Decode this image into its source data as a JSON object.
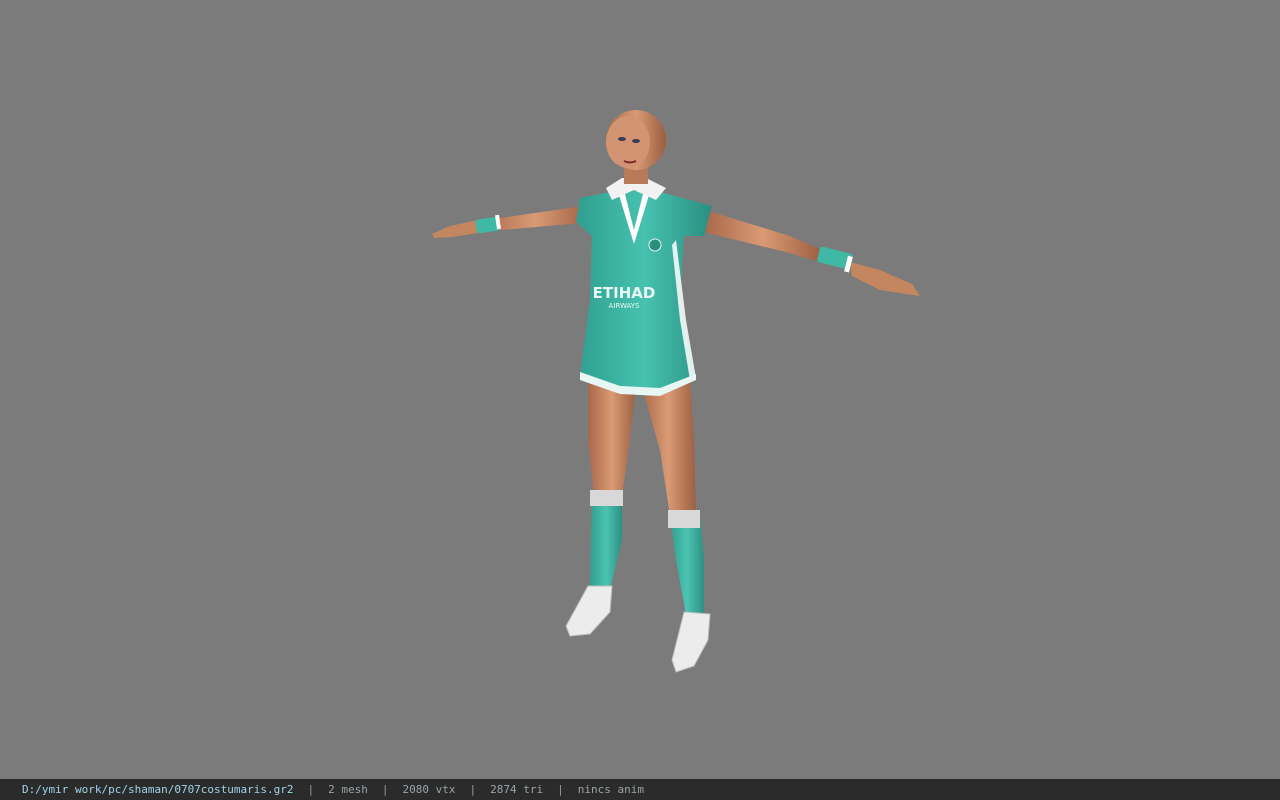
{
  "viewport": {
    "background_color": "#7b7b7b",
    "model": {
      "jersey_color": "#3fb8a6",
      "skin_color": "#c98a66",
      "shoe_color": "#e8e8e8",
      "sponsor_text": "ETIHAD",
      "sponsor_subtext": "AIRWAYS"
    }
  },
  "status_bar": {
    "file_path": "D:/ymir work/pc/shaman/0707costumaris.gr2",
    "separator": "|",
    "mesh_count": "2 mesh",
    "vertex_count": "2080 vtx",
    "triangle_count": "2874 tri",
    "anim_status": "nincs anim"
  }
}
